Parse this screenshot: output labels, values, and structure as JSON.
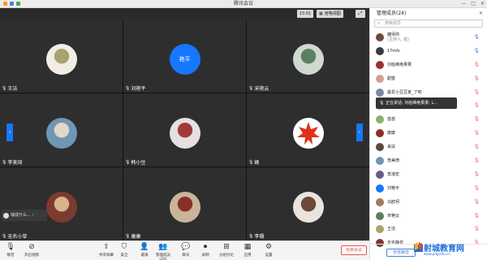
{
  "window": {
    "title": "腾讯会议"
  },
  "topbar": {
    "clock": "15:01",
    "view_label": "宫格视图"
  },
  "tiles": [
    {
      "name": "王洁",
      "kind": "photo",
      "colors": [
        "#f2eee6",
        "#a8a36c"
      ]
    },
    {
      "name": "刘艳平",
      "kind": "initials",
      "initials": "艳平"
    },
    {
      "name": "宋艳云",
      "kind": "photo",
      "colors": [
        "#cfd9cf",
        "#5c7f62"
      ]
    },
    {
      "name": "李美琦",
      "kind": "photo",
      "colors": [
        "#6f97b5",
        "#e6d6c8"
      ]
    },
    {
      "name": "韩小豆",
      "kind": "photo",
      "colors": [
        "#e6e0e0",
        "#a23a3a"
      ]
    },
    {
      "name": "峰",
      "kind": "leaf",
      "colors": [
        "#ffffff",
        "#e0301a"
      ]
    },
    {
      "name": "无名小草",
      "kind": "photo",
      "colors": [
        "#7c3b2f",
        "#d7b48c"
      ]
    },
    {
      "name": "康康",
      "kind": "photo",
      "colors": [
        "#c9b49a",
        "#8a2f25"
      ]
    },
    {
      "name": "李珊",
      "kind": "photo",
      "colors": [
        "#e9e4de",
        "#6b4a35"
      ]
    }
  ],
  "toast": {
    "text": "瑞成什么..."
  },
  "bottombar": {
    "buttons": [
      {
        "label": "静音",
        "icon": "mic-icon"
      },
      {
        "label": "开启视频",
        "icon": "camera-off-icon"
      },
      {
        "label": "共享屏幕",
        "icon": "share-screen-icon"
      },
      {
        "label": "安全",
        "icon": "shield-icon"
      },
      {
        "label": "邀请",
        "icon": "invite-icon"
      },
      {
        "label": "管理成员(24)",
        "icon": "members-icon"
      },
      {
        "label": "聊天",
        "icon": "chat-icon"
      },
      {
        "label": "录制",
        "icon": "record-icon"
      },
      {
        "label": "分组讨论",
        "icon": "breakout-icon"
      },
      {
        "label": "应用",
        "icon": "apps-icon"
      },
      {
        "label": "设置",
        "icon": "gear-icon"
      }
    ],
    "end_label": "结束会议"
  },
  "panel": {
    "title": "管理成员(24)",
    "search_placeholder": "搜索成员",
    "speaking": "正在讲话: 刘柏维绝果果; L...",
    "mute_all": "全体静音",
    "members": [
      {
        "name": "雕师你",
        "sub": "(主持人, 我)",
        "color": "#6c4b3a",
        "mic": "on"
      },
      {
        "name": "17mfs",
        "color": "#3a3a3a",
        "mic": "on"
      },
      {
        "name": "刘柏维绝果果",
        "color": "#9c2f2f",
        "mic": "off"
      },
      {
        "name": "甜蜜",
        "color": "#d3a08a",
        "mic": "off"
      },
      {
        "name": "最爱小豆豆家_了吧",
        "color": "#7a8aa0",
        "mic": "off"
      },
      {
        "name": "林小豆",
        "color": "#b7a28a",
        "mic": "off"
      },
      {
        "name": "苗苗",
        "color": "#8ab06a",
        "mic": "off"
      },
      {
        "name": "康康",
        "color": "#8a2f25",
        "mic": "off"
      },
      {
        "name": "来扶",
        "color": "#5a4a3a",
        "mic": "off"
      },
      {
        "name": "李美琦",
        "color": "#6f97b5",
        "mic": "off"
      },
      {
        "name": "李淑宏",
        "color": "#6a5a8a",
        "mic": "off"
      },
      {
        "name": "刘艳平",
        "color": "#1677ff",
        "mic": "off"
      },
      {
        "name": "马欧柯",
        "color": "#a07a5a",
        "mic": "off"
      },
      {
        "name": "宋艳云",
        "color": "#5c7f62",
        "mic": "off"
      },
      {
        "name": "王洁",
        "color": "#a8a36c",
        "mic": "off"
      },
      {
        "name": "无名静音",
        "color": "#7c3b2f",
        "mic": "off"
      }
    ]
  },
  "watermark": {
    "line1": "射城教育网",
    "line2": "www.pdjyedu.cn"
  }
}
